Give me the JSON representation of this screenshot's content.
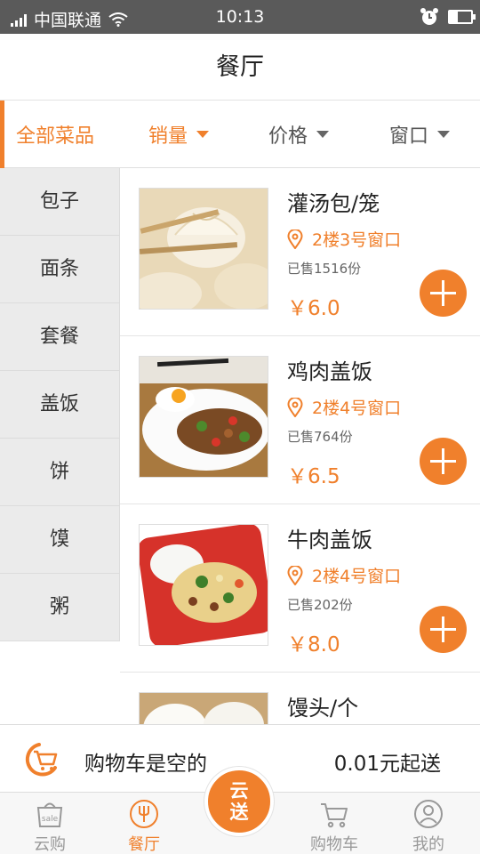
{
  "status_bar": {
    "carrier": "中国联通",
    "time": "10:13"
  },
  "header": {
    "title": "餐厅"
  },
  "filters": {
    "all_label": "全部菜品",
    "sort_sales": "销量",
    "sort_price": "价格",
    "sort_window": "窗口"
  },
  "sidebar": {
    "items": [
      {
        "label": "包子"
      },
      {
        "label": "面条"
      },
      {
        "label": "套餐"
      },
      {
        "label": "盖饭"
      },
      {
        "label": "饼"
      },
      {
        "label": "馍"
      },
      {
        "label": "粥"
      }
    ]
  },
  "dishes": [
    {
      "name": "灌汤包/笼",
      "location": "2楼3号窗口",
      "sold": "已售1516份",
      "price": "￥6.0"
    },
    {
      "name": "鸡肉盖饭",
      "location": "2楼4号窗口",
      "sold": "已售764份",
      "price": "￥6.5"
    },
    {
      "name": "牛肉盖饭",
      "location": "2楼4号窗口",
      "sold": "已售202份",
      "price": "￥8.0"
    },
    {
      "name": "馒头/个"
    }
  ],
  "cart": {
    "empty_text": "购物车是空的",
    "min_delivery": "0.01元起送"
  },
  "bottom_nav": {
    "items": [
      {
        "label": "云购"
      },
      {
        "label": "餐厅"
      },
      {
        "label": "购物车"
      },
      {
        "label": "我的"
      }
    ],
    "center_line1": "云",
    "center_line2": "送"
  },
  "colors": {
    "accent": "#f0802c",
    "status_bar": "#5a5a5a",
    "sidebar_bg": "#ebebeb"
  }
}
